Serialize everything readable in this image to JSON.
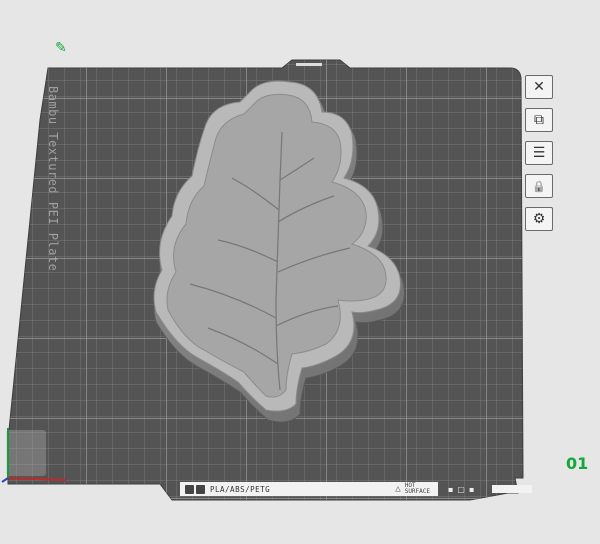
{
  "plate": {
    "label": "Bambu Textured PEI Plate",
    "number": "01",
    "filament_types": "PLA/ABS/PETG",
    "surface_note_line1": "HOT",
    "surface_note_line2": "SURFACE"
  },
  "toolbar": {
    "buttons": [
      {
        "name": "close",
        "icon": "close-icon",
        "glyph": "✕"
      },
      {
        "name": "arrange",
        "icon": "arrange-icon",
        "glyph": "⧉"
      },
      {
        "name": "plate-settings",
        "icon": "plate-settings-icon",
        "glyph": "☰"
      },
      {
        "name": "lock",
        "icon": "lock-icon",
        "glyph": "🔒"
      },
      {
        "name": "settings",
        "icon": "gear-icon",
        "glyph": "⚙"
      }
    ]
  },
  "colors": {
    "background": "#e6e6e6",
    "plate": "#545454",
    "grid": "#7c7c7c",
    "model": "#9e9e9e",
    "accent": "#11a83a"
  }
}
